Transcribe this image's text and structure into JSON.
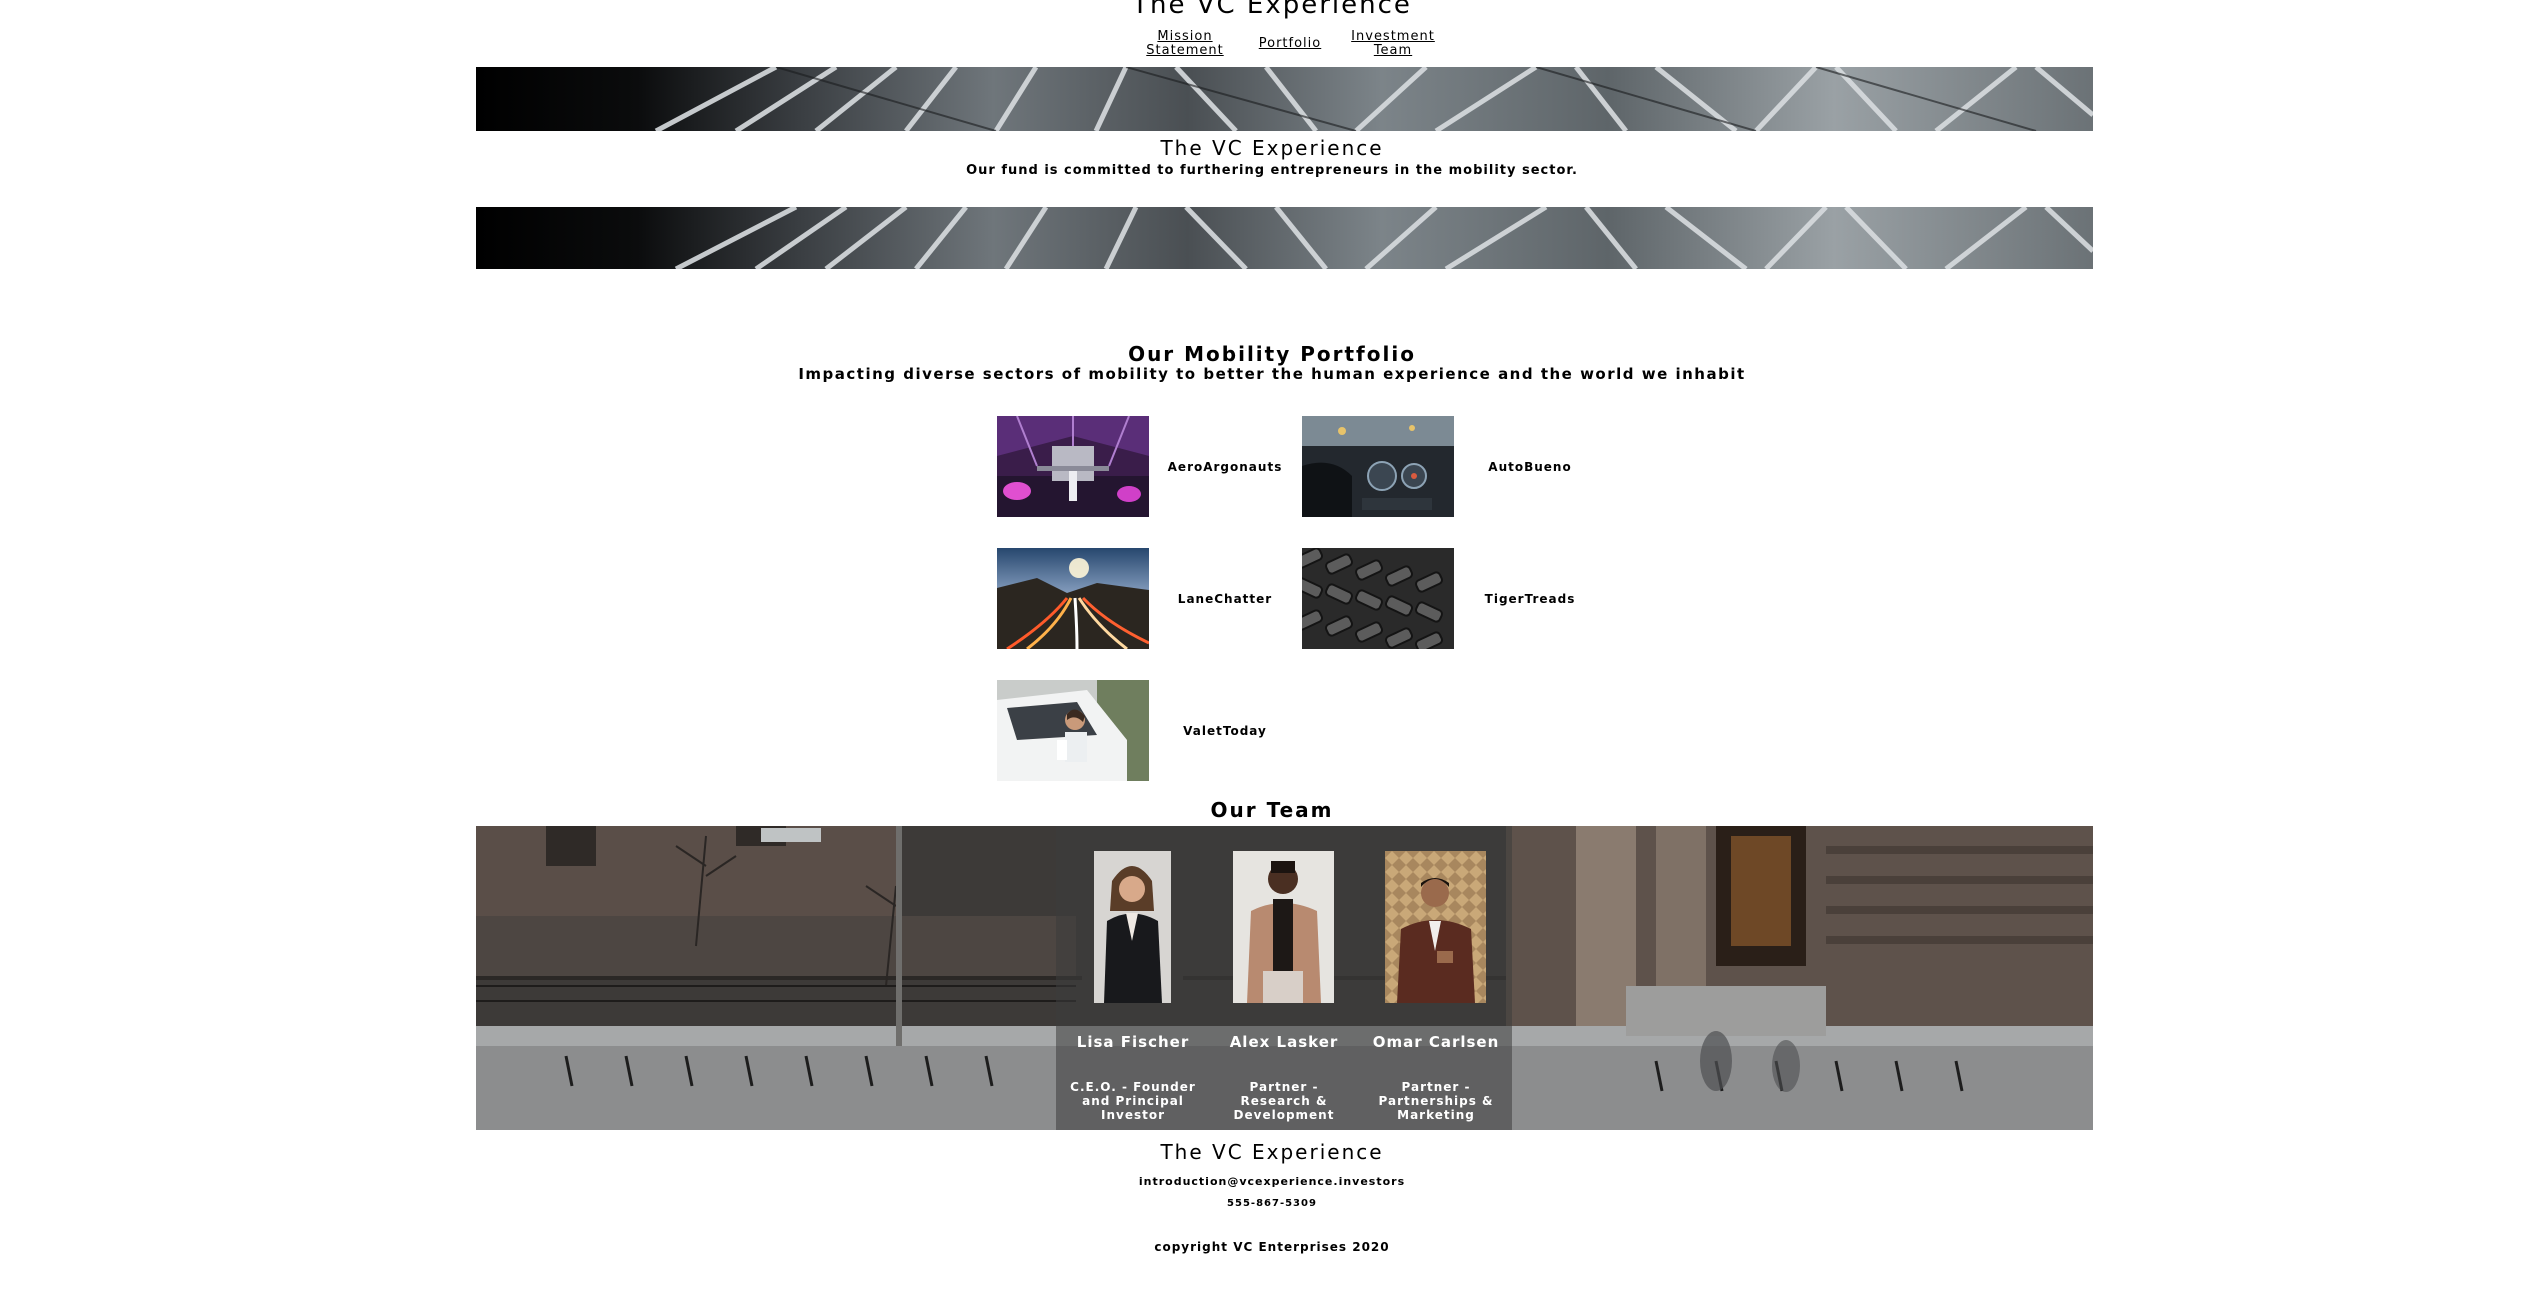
{
  "site": {
    "title": "The VC Experience"
  },
  "nav": {
    "mission": "Mission Statement",
    "portfolio": "Portfolio",
    "team": "Investment Team"
  },
  "hero": {
    "title": "The VC Experience",
    "subtitle": "Our fund is committed to furthering entrepreneurs in the mobility sector."
  },
  "portfolio": {
    "title": "Our Mobility Portfolio",
    "subtitle": "Impacting diverse sectors of mobility to better the human experience and the world we inhabit",
    "items": [
      {
        "name": "AeroArgonauts",
        "image": "aircraft-hangar-photo"
      },
      {
        "name": "AutoBueno",
        "image": "car-dashboard-photo"
      },
      {
        "name": "LaneChatter",
        "image": "highway-light-trails-photo"
      },
      {
        "name": "TigerTreads",
        "image": "tire-treads-photo"
      },
      {
        "name": "ValetToday",
        "image": "valet-driver-photo"
      }
    ]
  },
  "team": {
    "title": "Our Team",
    "members": [
      {
        "name": "Lisa Fischer",
        "role": "C.E.O. - Founder and Principal Investor"
      },
      {
        "name": "Alex Lasker",
        "role": "Partner - Research & Development"
      },
      {
        "name": "Omar Carlsen",
        "role": "Partner - Partnerships & Marketing"
      }
    ]
  },
  "footer": {
    "title": "The VC Experience",
    "email": "introduction@vcexperience.investors",
    "phone": "555-867-5309",
    "copyright": "copyright VC Enterprises 2020"
  },
  "colors": {
    "text": "#000000",
    "team_overlay": "#3c3c3c",
    "banner_dark": "#0b0c0d",
    "banner_light": "#9aa1a5"
  }
}
